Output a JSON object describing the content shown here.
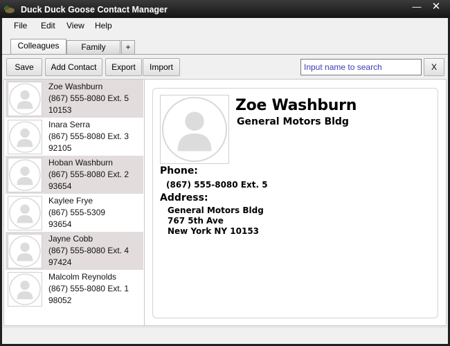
{
  "window": {
    "title": "Duck Duck Goose Contact Manager",
    "minimize": "—",
    "close": "✕"
  },
  "menu": {
    "file": "File",
    "edit": "Edit",
    "view": "View",
    "help": "Help"
  },
  "tabs": {
    "colleagues": "Colleagues",
    "family": "Family",
    "add": "+"
  },
  "toolbar": {
    "save": "Save",
    "add_contact": "Add Contact",
    "export": "Export",
    "import": "Import",
    "clear": "X"
  },
  "search": {
    "placeholder": "Input name to search"
  },
  "contacts": [
    {
      "name": "Zoe Washburn",
      "phone": "(867) 555-8080 Ext. 5",
      "zip": "10153"
    },
    {
      "name": "Inara Serra",
      "phone": "(867) 555-8080 Ext. 3",
      "zip": "92105"
    },
    {
      "name": "Hoban Washburn",
      "phone": "(867) 555-8080 Ext. 2",
      "zip": "93654"
    },
    {
      "name": "Kaylee Frye",
      "phone": "(867) 555-5309",
      "zip": "93654"
    },
    {
      "name": "Jayne Cobb",
      "phone": "(867) 555-8080 Ext. 4",
      "zip": "97424"
    },
    {
      "name": "Malcolm Reynolds",
      "phone": "(867) 555-8080 Ext. 1",
      "zip": "98052"
    }
  ],
  "detail": {
    "name": "Zoe Washburn",
    "company": "General Motors Bldg",
    "phone_label": "Phone:",
    "phone": "(867) 555-8080 Ext. 5",
    "address_label": "Address:",
    "address_line1": "General Motors Bldg",
    "address_line2": "767 5th Ave",
    "address_line3": "New York NY 10153"
  },
  "colors": {
    "selected_row": "#e2dcdc",
    "titlebar": "#1e1e1e",
    "search_text": "#3b3bb5"
  }
}
